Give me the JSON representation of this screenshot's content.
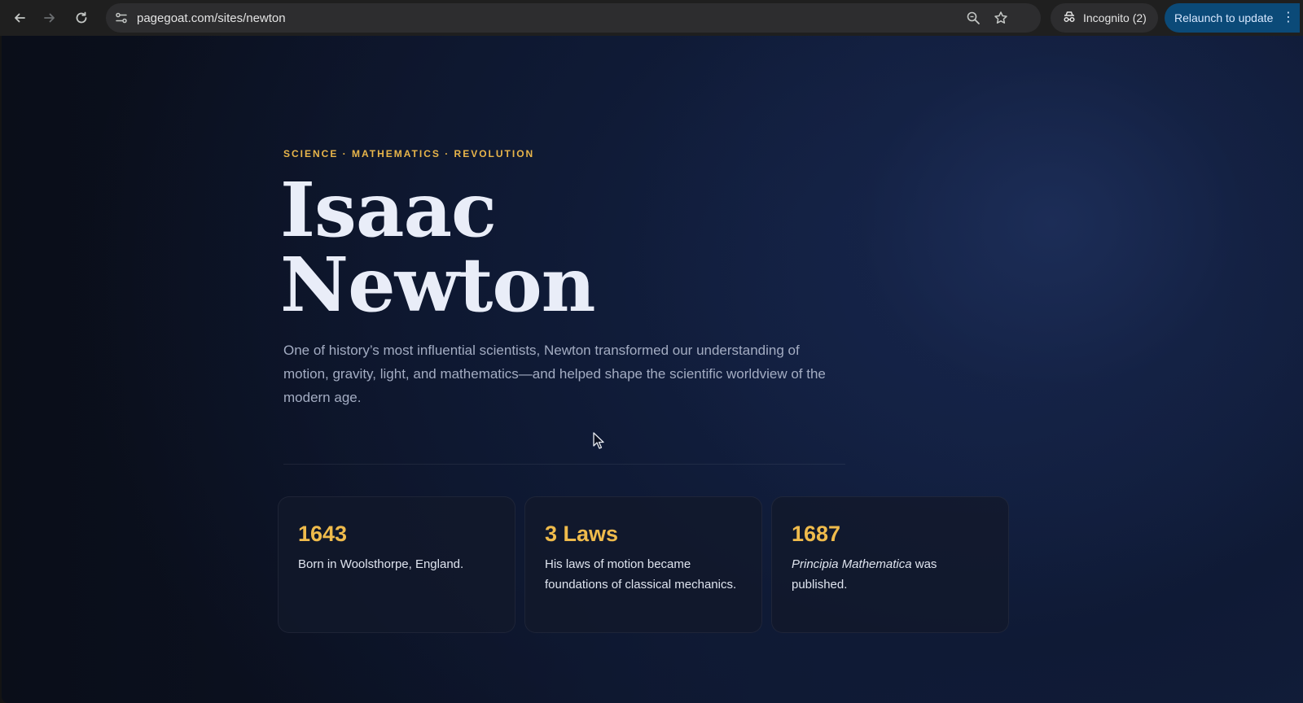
{
  "browser": {
    "url": "pagegoat.com/sites/newton",
    "incognito_label": "Incognito (2)",
    "relaunch_label": "Relaunch to update",
    "icons": [
      "back-arrow-icon",
      "forward-arrow-icon",
      "reload-icon",
      "site-info-icon",
      "zoom-icon",
      "bookmark-star-icon",
      "incognito-icon",
      "kebab-menu-icon"
    ]
  },
  "hero": {
    "eyebrow": "SCIENCE · MATHEMATICS · REVOLUTION",
    "title_line1": "Isaac",
    "title_line2": "Newton",
    "lead": "One of history’s most influential scientists, Newton transformed our understanding of motion, gravity, light, and mathematics—and helped shape the scientific worldview of the modern age."
  },
  "cards": [
    {
      "stat": "1643",
      "desc": "Born in Woolsthorpe, England."
    },
    {
      "stat": "3 Laws",
      "desc": "His laws of motion became foundations of classical mechanics."
    },
    {
      "stat": "1687",
      "desc_em": "Principia Mathematica",
      "desc_rest": " was published."
    }
  ],
  "colors": {
    "accent_gold": "#efbb4c",
    "title_white": "#e9edf8",
    "relaunch_blue": "#0b4a78"
  }
}
